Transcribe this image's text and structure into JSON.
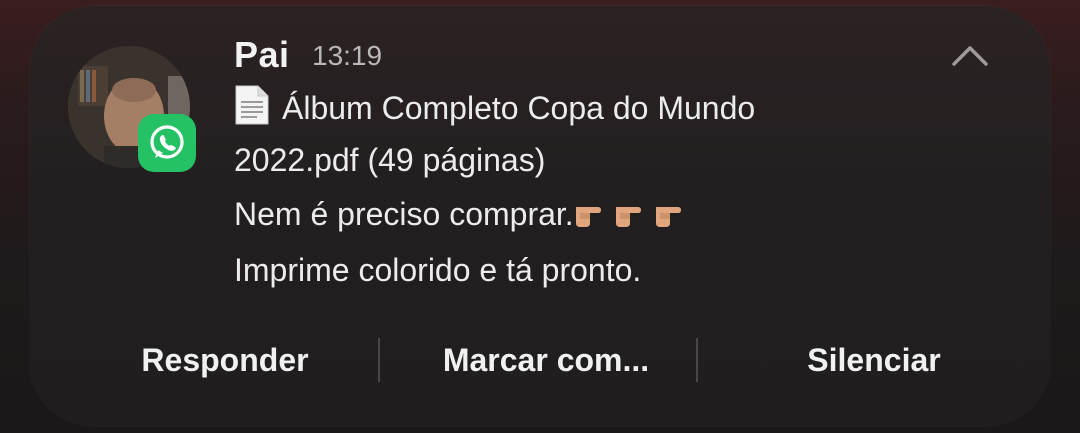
{
  "notification": {
    "sender": "Pai",
    "time": "13:19",
    "attachment_line1": "Álbum Completo Copa do Mundo",
    "attachment_line2": "2022.pdf (49 páginas)",
    "message_line1": "Nem é preciso comprar.",
    "message_line2": "Imprime colorido e tá pronto.",
    "app_icon": "whatsapp-icon",
    "collapse_icon": "chevron-up-icon",
    "attachment_icon": "document-icon",
    "emoji": "pointing-right-hand-icon"
  },
  "actions": {
    "reply": "Responder",
    "mark": "Marcar com...",
    "mute": "Silenciar"
  },
  "colors": {
    "whatsapp_green": "#25c265",
    "card_bg": "#231f20",
    "text_primary": "#f2f2f2",
    "text_secondary": "#b9b7b7"
  }
}
